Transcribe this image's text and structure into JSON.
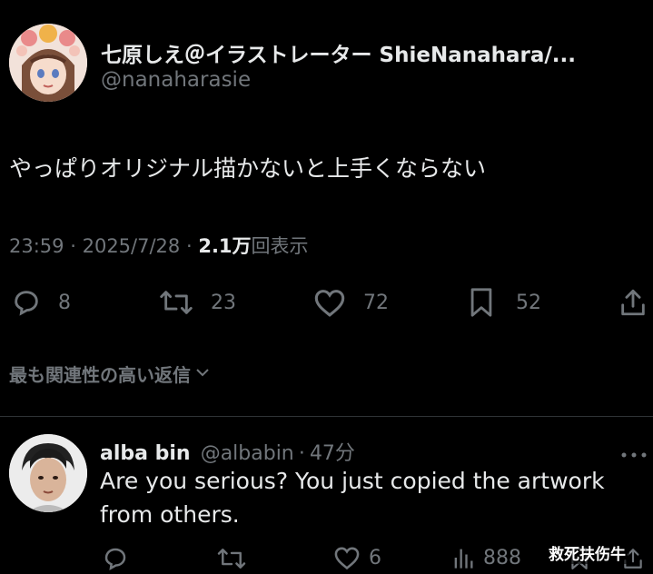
{
  "tweet": {
    "display_name": "七原しえ＠イラストレーター ShieNanahara/...",
    "handle": "@nanaharasie",
    "text": "やっぱりオリジナル描かないと上手くならない",
    "time": "23:59",
    "date": "2025/7/28",
    "views_count": "2.1万",
    "views_label": "回表示",
    "sep": "·",
    "replies": "8",
    "retweets": "23",
    "likes": "72",
    "bookmarks": "52"
  },
  "sort_label": "最も関連性の高い返信",
  "reply": {
    "display_name": "alba bin",
    "handle": "@albabin",
    "time": "47分",
    "sep": "·",
    "text": "Are you serious? You just copied the artwork from others.",
    "likes": "6",
    "views": "888"
  },
  "watermark": "救死扶伤牛",
  "icons": {
    "reply": "speech-bubble-icon",
    "retweet": "retweet-arrows-icon",
    "like": "heart-icon",
    "bookmark": "bookmark-icon",
    "share": "share-upload-icon",
    "views": "bar-chart-icon",
    "more": "more-dots-icon"
  }
}
